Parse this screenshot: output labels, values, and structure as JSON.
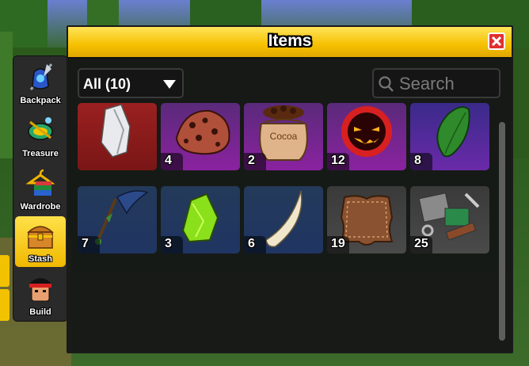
{
  "panel": {
    "title": "Items",
    "filter_label": "All (10)",
    "search_placeholder": "Search"
  },
  "side_menu": [
    {
      "label": "Backpack",
      "icon": "backpack-icon",
      "active": false
    },
    {
      "label": "Treasure",
      "icon": "treasure-icon",
      "active": false
    },
    {
      "label": "Wardrobe",
      "icon": "wardrobe-icon",
      "active": false
    },
    {
      "label": "Stash",
      "icon": "chest-icon",
      "active": true
    },
    {
      "label": "Build",
      "icon": "build-avatar-icon",
      "active": false
    }
  ],
  "items": [
    {
      "icon": "crystal-shard-icon",
      "count": "",
      "rarity_color": "#8a1a1a"
    },
    {
      "icon": "magma-ore-icon",
      "count": "4",
      "rarity_color": "#7a1d8a"
    },
    {
      "icon": "cocoa-bag-icon",
      "count": "2",
      "rarity_color": "#7a1d8a",
      "bag_text": "Cocoa"
    },
    {
      "icon": "demonic-wisp-icon",
      "count": "12",
      "rarity_color": "#7a1d8a"
    },
    {
      "icon": "leaf-icon",
      "count": "8",
      "rarity_color": "#5a2a9a"
    },
    {
      "icon": "fish-tail-icon",
      "count": "7",
      "rarity_color": "#1f3a6a"
    },
    {
      "icon": "radioactive-material-icon",
      "count": "3",
      "rarity_color": "#1f3a6a"
    },
    {
      "icon": "fang-icon",
      "count": "6",
      "rarity_color": "#1f3a6a"
    },
    {
      "icon": "leather-icon",
      "count": "19",
      "rarity_color": "#3c3c3c"
    },
    {
      "icon": "scrap-metal-icon",
      "count": "25",
      "rarity_color": "#3c3c3c"
    }
  ],
  "colors": {
    "header_yellow": "#f6c000",
    "close_red": "#e03030",
    "active_tab_yellow": "#ffd21e"
  }
}
